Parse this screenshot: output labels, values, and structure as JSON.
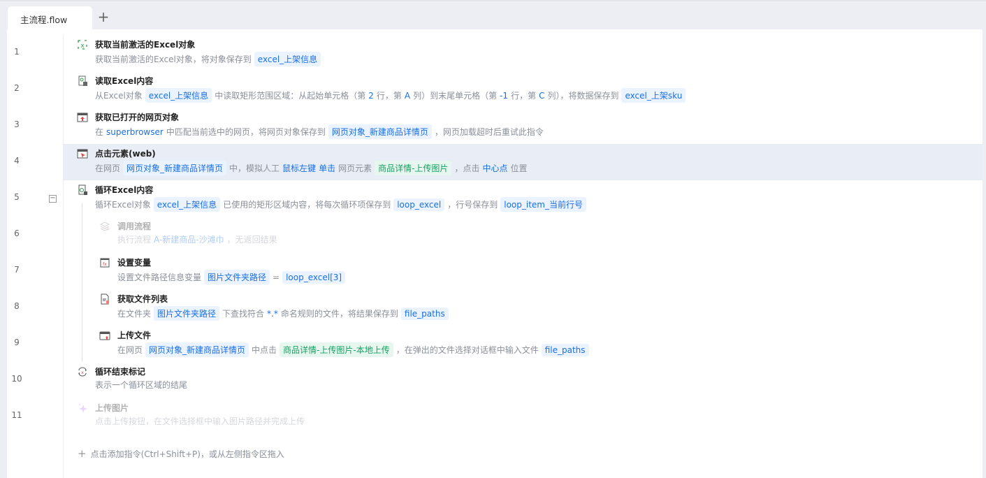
{
  "tabs": [
    {
      "label": "主流程.flow"
    }
  ],
  "add_tab_label": "+",
  "rows": [
    {
      "num": "1",
      "level": 0,
      "icon": "excel-object-icon",
      "title": "获取当前激活的Excel对象",
      "desc": [
        {
          "t": "text",
          "v": "获取当前激活的Excel对象，将对象保存到"
        },
        {
          "t": "chip",
          "v": "excel_上架信息"
        }
      ]
    },
    {
      "num": "2",
      "level": 0,
      "icon": "read-excel-icon",
      "title": "读取Excel内容",
      "desc": [
        {
          "t": "text",
          "v": "从Excel对象"
        },
        {
          "t": "chip",
          "v": "excel_上架信息"
        },
        {
          "t": "text",
          "v": "中读取矩形范围区域：从起始单元格（第"
        },
        {
          "t": "link",
          "v": "2"
        },
        {
          "t": "text",
          "v": "行，第"
        },
        {
          "t": "link",
          "v": "A"
        },
        {
          "t": "text",
          "v": "列）到末尾单元格（第"
        },
        {
          "t": "link",
          "v": "-1"
        },
        {
          "t": "text",
          "v": "行，第"
        },
        {
          "t": "link",
          "v": "C"
        },
        {
          "t": "text",
          "v": "列），将数据保存到"
        },
        {
          "t": "chip",
          "v": "excel_上架sku"
        }
      ]
    },
    {
      "num": "3",
      "level": 0,
      "icon": "browser-page-icon",
      "title": "获取已打开的网页对象",
      "desc": [
        {
          "t": "text",
          "v": "在"
        },
        {
          "t": "link",
          "v": "superbrowser"
        },
        {
          "t": "text",
          "v": "中匹配当前选中的网页，将网页对象保存到"
        },
        {
          "t": "chip",
          "v": "网页对象_新建商品详情页"
        },
        {
          "t": "text",
          "v": "，网页加载超时后重试此指令"
        }
      ]
    },
    {
      "num": "4",
      "level": 0,
      "icon": "click-element-icon",
      "title": "点击元素(web)",
      "highlight": true,
      "desc": [
        {
          "t": "text",
          "v": "在网页"
        },
        {
          "t": "chip",
          "v": "网页对象_新建商品详情页"
        },
        {
          "t": "text",
          "v": "中，模拟人工"
        },
        {
          "t": "link",
          "v": "鼠标左键"
        },
        {
          "t": "link",
          "v": "单击"
        },
        {
          "t": "text",
          "v": "网页元素"
        },
        {
          "t": "green",
          "v": "商品详情-上传图片"
        },
        {
          "t": "text",
          "v": "，点击"
        },
        {
          "t": "link",
          "v": "中心点"
        },
        {
          "t": "text",
          "v": "位置"
        }
      ]
    },
    {
      "num": "5",
      "level": 0,
      "icon": "loop-excel-icon",
      "title": "循环Excel内容",
      "collapsible": true,
      "desc": [
        {
          "t": "text",
          "v": "循环Excel对象"
        },
        {
          "t": "chip",
          "v": "excel_上架信息"
        },
        {
          "t": "text",
          "v": "已使用的矩形区域内容，将每次循环项保存到"
        },
        {
          "t": "chip",
          "v": "loop_excel"
        },
        {
          "t": "text",
          "v": "，行号保存到"
        },
        {
          "t": "chip",
          "v": "loop_item_当前行号"
        }
      ]
    },
    {
      "num": "6",
      "level": 1,
      "icon": "call-flow-icon",
      "title": "调用流程",
      "disabled": true,
      "desc": [
        {
          "t": "text",
          "v": "执行流程"
        },
        {
          "t": "link",
          "v": "A-新建商品-沙滩巾"
        },
        {
          "t": "text",
          "v": "，无返回结果"
        }
      ]
    },
    {
      "num": "7",
      "level": 1,
      "icon": "set-variable-icon",
      "title": "设置变量",
      "desc": [
        {
          "t": "text",
          "v": "设置文件路径信息变量"
        },
        {
          "t": "chip",
          "v": "图片文件夹路径"
        },
        {
          "t": "text",
          "v": "="
        },
        {
          "t": "chip",
          "v": "loop_excel[3]"
        }
      ]
    },
    {
      "num": "8",
      "level": 1,
      "icon": "file-list-icon",
      "title": "获取文件列表",
      "desc": [
        {
          "t": "text",
          "v": "在文件夹"
        },
        {
          "t": "chip",
          "v": "图片文件夹路径"
        },
        {
          "t": "text",
          "v": "下查找符合"
        },
        {
          "t": "link",
          "v": "*.*"
        },
        {
          "t": "text",
          "v": "命名规则的文件，将结果保存到"
        },
        {
          "t": "chip",
          "v": "file_paths"
        }
      ]
    },
    {
      "num": "9",
      "level": 1,
      "icon": "upload-file-icon",
      "title": "上传文件",
      "desc": [
        {
          "t": "text",
          "v": "在网页"
        },
        {
          "t": "chip",
          "v": "网页对象_新建商品详情页"
        },
        {
          "t": "text",
          "v": "中点击"
        },
        {
          "t": "green",
          "v": "商品详情-上传图片-本地上传"
        },
        {
          "t": "text",
          "v": "，在弹出的文件选择对话框中输入文件"
        },
        {
          "t": "chip",
          "v": "file_paths"
        }
      ]
    },
    {
      "num": "10",
      "level": 0,
      "icon": "loop-end-icon",
      "title": "循环结束标记",
      "desc": [
        {
          "t": "text",
          "v": "表示一个循环区域的结尾"
        }
      ]
    },
    {
      "num": "11",
      "level": 0,
      "icon": "ai-sparkle-icon",
      "title": "上传图片",
      "disabled": true,
      "desc": [
        {
          "t": "text",
          "v": "点击上传按钮，在文件选择框中输入图片路径并完成上传"
        }
      ]
    }
  ],
  "add_command": {
    "plus": "+",
    "label": "点击添加指令(Ctrl+Shift+P)，或从左侧指令区拖入"
  },
  "collapse_symbol": "−",
  "colors": {
    "accent": "#1a6fe0",
    "green": "#14a063",
    "highlight": "#e9edf5"
  }
}
